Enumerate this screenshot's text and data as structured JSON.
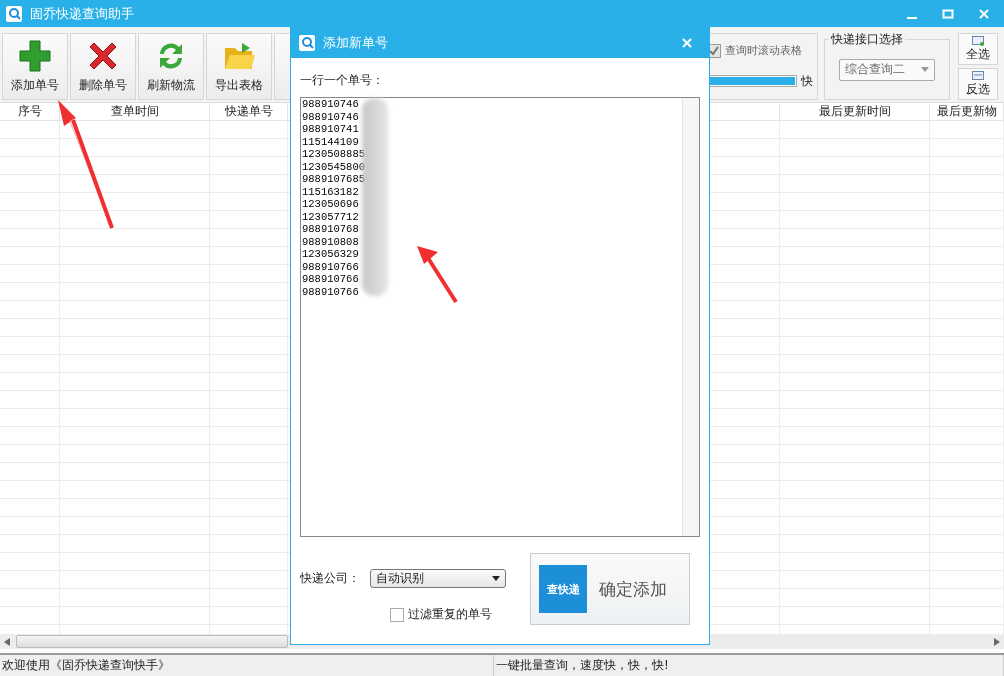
{
  "window": {
    "title": "固乔快递查询助手"
  },
  "toolbar": {
    "buttons": [
      {
        "kind": "add",
        "label": "添加单号"
      },
      {
        "kind": "delete",
        "label": "删除单号"
      },
      {
        "kind": "refresh",
        "label": "刷新物流"
      },
      {
        "kind": "export",
        "label": "导出表格"
      },
      {
        "kind": "hidden"
      }
    ],
    "scroll_checkbox": {
      "label": "查询时滚动表格",
      "checked": true,
      "disabled": true
    },
    "speed": {
      "level": 1,
      "label": "快"
    },
    "interface_group": {
      "title": "快递接口选择",
      "value": "综合查询二"
    },
    "select_all": "全选",
    "invert_selection": "反选"
  },
  "table": {
    "columns": [
      {
        "label": "序号"
      },
      {
        "label": "查单时间"
      },
      {
        "label": "快递单号"
      },
      {},
      {
        "label": "最后更新时间"
      },
      {
        "label": "最后更新物"
      }
    ]
  },
  "status_bar": {
    "left": "欢迎使用《固乔快递查询快手》",
    "right": "一键批量查询，速度快，快，快!"
  },
  "dialog": {
    "title": "添加新单号",
    "prompt": "一行一个单号：",
    "numbers": [
      "988910746",
      "988910746",
      "988910741",
      "115144109",
      "1230508885",
      "1230545800",
      "9889107685",
      "115163182",
      "123050696",
      "123057712",
      "988910768",
      "988910808",
      "123056329",
      "988910766",
      "988910766",
      "988910766"
    ],
    "company_label": "快递公司：",
    "company_value": "自动识别",
    "filter_checkbox": {
      "label": "过滤重复的单号",
      "checked": false
    },
    "confirm": {
      "logo_text": "查快递",
      "label": "确定添加"
    }
  }
}
